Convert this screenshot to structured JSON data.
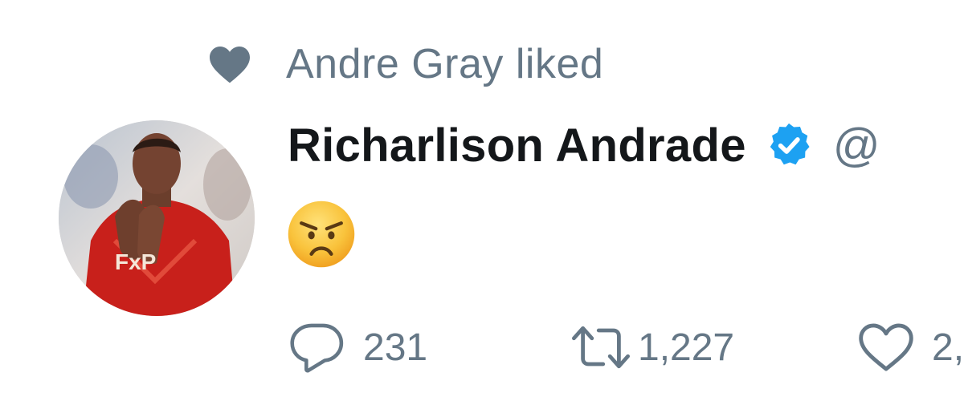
{
  "social_context": {
    "text": "Andre Gray liked"
  },
  "tweet": {
    "author": {
      "display_name": "Richarlison Andrade",
      "handle": "@"
    },
    "body": {
      "emoji_name": "angry-face",
      "emoji": "😠"
    },
    "actions": {
      "replies": "231",
      "retweets": "1,227",
      "likes": "2,"
    }
  },
  "colors": {
    "muted": "#657786",
    "text": "#14171a",
    "verified": "#1da1f2"
  }
}
